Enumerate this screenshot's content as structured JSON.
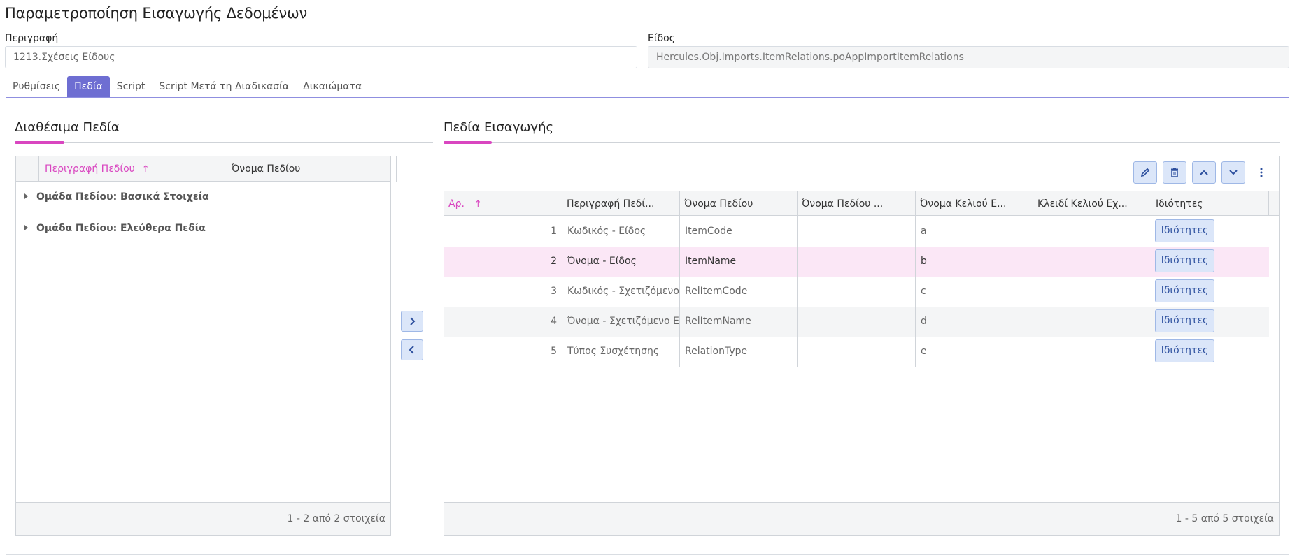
{
  "page": {
    "title": "Παραμετροποίηση Εισαγωγής Δεδομένων"
  },
  "form": {
    "description_label": "Περιγραφή",
    "description_value": "1213.Σχέσεις Είδους",
    "type_label": "Είδος",
    "type_value": "Hercules.Obj.Imports.ItemRelations.poAppImportItemRelations"
  },
  "tabs": [
    {
      "label": "Ρυθμίσεις",
      "active": false
    },
    {
      "label": "Πεδία",
      "active": true
    },
    {
      "label": "Script",
      "active": false
    },
    {
      "label": "Script Μετά τη Διαδικασία",
      "active": false
    },
    {
      "label": "Δικαιώματα",
      "active": false
    }
  ],
  "available": {
    "title": "Διαθέσιμα Πεδία",
    "columns": [
      "Περιγραφή Πεδίου",
      "Όνομα Πεδίου"
    ],
    "sort_icon": "↑",
    "groups": [
      {
        "label": "Ομάδα Πεδίου: Βασικά Στοιχεία"
      },
      {
        "label": "Ομάδα Πεδίου: Ελεύθερα Πεδία"
      }
    ],
    "footer": "1 - 2 από 2 στοιχεία"
  },
  "imported": {
    "title": "Πεδία Εισαγωγής",
    "sort_icon": "↑",
    "columns": [
      "Αρ.",
      "Περιγραφή Πεδί...",
      "Όνομα Πεδίου",
      "Όνομα Πεδίου ...",
      "Όνομα Κελιού Ε...",
      "Κλειδί Κελιού Εχ...",
      "Ιδιότητες"
    ],
    "rows": [
      {
        "no": "1",
        "desc": "Κωδικός - Είδος",
        "name": "ItemCode",
        "name2": "",
        "cell": "a",
        "key": "",
        "btn": "Ιδιότητες"
      },
      {
        "no": "2",
        "desc": "Όνομα - Είδος",
        "name": "ItemName",
        "name2": "",
        "cell": "b",
        "key": "",
        "btn": "Ιδιότητες"
      },
      {
        "no": "3",
        "desc": "Κωδικός - Σχετιζόμενο Είδος",
        "name": "RelItemCode",
        "name2": "",
        "cell": "c",
        "key": "",
        "btn": "Ιδιότητες"
      },
      {
        "no": "4",
        "desc": "Όνομα - Σχετιζόμενο Είδος",
        "name": "RelItemName",
        "name2": "",
        "cell": "d",
        "key": "",
        "btn": "Ιδιότητες"
      },
      {
        "no": "5",
        "desc": "Τύπος Συσχέτησης",
        "name": "RelationType",
        "name2": "",
        "cell": "e",
        "key": "",
        "btn": "Ιδιότητες"
      }
    ],
    "footer": "1 - 5 από 5 στοιχεία"
  },
  "icons": {
    "move_right": "chevron-right-icon",
    "move_left": "chevron-left-icon",
    "edit": "pencil-icon",
    "delete": "trash-icon",
    "up": "chevron-up-icon",
    "down": "chevron-down-icon",
    "more": "more-vertical-icon"
  },
  "colors": {
    "accent": "#d946c0",
    "tab_active": "#6e6ed2",
    "selected_row": "#fbe7f6",
    "alt_row": "#f4f5f6",
    "button_bg": "#dbe6f9"
  }
}
